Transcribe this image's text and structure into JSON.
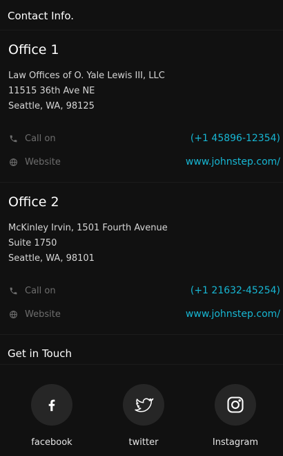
{
  "contact_header": "Contact Info.",
  "offices": [
    {
      "title": "Office 1",
      "address": [
        "Law Offices of O. Yale Lewis III, LLC",
        "11515 36th Ave NE",
        "Seattle, WA, 98125"
      ],
      "call_label": "Call on",
      "phone": "(+1 45896-12354)",
      "website_label": "Website",
      "website": "www.johnstep.com/"
    },
    {
      "title": "Office 2",
      "address": [
        "McKinley Irvin, 1501 Fourth Avenue",
        "Suite 1750",
        "Seattle, WA, 98101"
      ],
      "call_label": "Call on",
      "phone": "(+1 21632-45254)",
      "website_label": "Website",
      "website": "www.johnstep.com/"
    }
  ],
  "get_in_touch_header": "Get in Touch",
  "social": [
    {
      "name": "facebook",
      "icon": "facebook-icon"
    },
    {
      "name": "twitter",
      "icon": "twitter-icon"
    },
    {
      "name": "Instagram",
      "icon": "instagram-icon"
    }
  ],
  "colors": {
    "background": "#111111",
    "accent": "#17b7d4",
    "muted": "#6e6e6e",
    "circle": "#262626"
  }
}
